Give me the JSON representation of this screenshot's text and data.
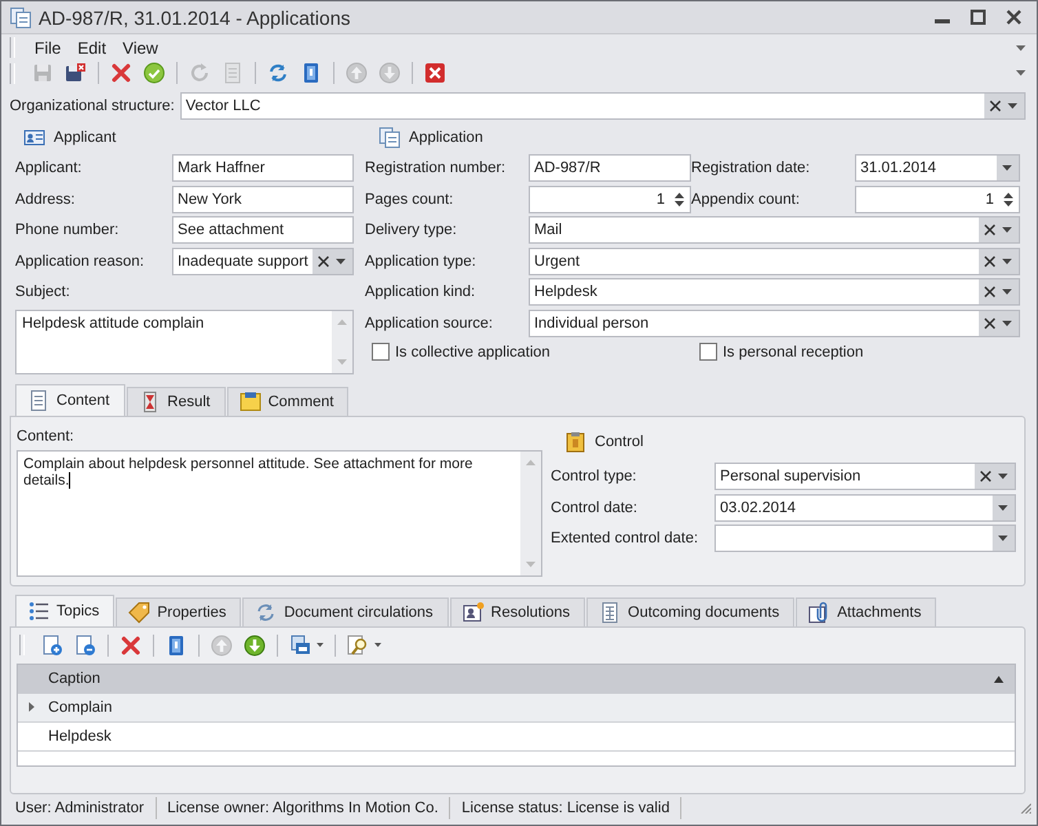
{
  "window": {
    "title": "AD-987/R, 31.01.2014 - Applications"
  },
  "menu": [
    "File",
    "Edit",
    "View"
  ],
  "toolbar": [
    [
      {
        "kind": "save",
        "disabled": true
      },
      {
        "kind": "save-close",
        "disabled": false
      }
    ],
    [
      {
        "kind": "delete",
        "disabled": false
      },
      {
        "kind": "accept",
        "disabled": false
      }
    ],
    [
      {
        "kind": "refresh",
        "disabled": true
      },
      {
        "kind": "document",
        "disabled": true
      }
    ],
    [
      {
        "kind": "sync",
        "disabled": false
      },
      {
        "kind": "book",
        "disabled": false
      }
    ],
    [
      {
        "kind": "up",
        "disabled": true
      },
      {
        "kind": "down",
        "disabled": true
      }
    ],
    [
      {
        "kind": "close",
        "disabled": false
      }
    ]
  ],
  "org_structure": {
    "label": "Organizational structure:",
    "value": "Vector LLC"
  },
  "applicant": {
    "title": "Applicant",
    "fields": [
      {
        "label": "Applicant:",
        "value": "Mark Haffner",
        "kind": "text"
      },
      {
        "label": "Address:",
        "value": "New York",
        "kind": "text"
      },
      {
        "label": "Phone number:",
        "value": "See attachment",
        "kind": "text"
      },
      {
        "label": "Application reason:",
        "value": "Inadequate support",
        "kind": "lookup"
      }
    ],
    "subject": {
      "label": "Subject:",
      "value": "Helpdesk attitude complain"
    }
  },
  "application": {
    "title": "Application",
    "rows": [
      {
        "fields": [
          {
            "label": "Registration number:",
            "value": "AD-987/R",
            "kind": "text"
          },
          {
            "label": "Registration date:",
            "value": "31.01.2014",
            "kind": "date"
          }
        ]
      },
      {
        "fields": [
          {
            "label": "Pages count:",
            "value": "1",
            "kind": "spin"
          },
          {
            "label": "Appendix count:",
            "value": "1",
            "kind": "spin"
          }
        ]
      },
      {
        "fields": [
          {
            "label": "Delivery type:",
            "value": "Mail",
            "kind": "lookup"
          }
        ]
      },
      {
        "fields": [
          {
            "label": "Application type:",
            "value": "Urgent",
            "kind": "lookup"
          }
        ]
      },
      {
        "fields": [
          {
            "label": "Application kind:",
            "value": "Helpdesk",
            "kind": "lookup"
          }
        ]
      },
      {
        "fields": [
          {
            "label": "Application source:",
            "value": "Individual person",
            "kind": "lookup"
          }
        ]
      }
    ],
    "checkboxes": [
      {
        "label": "Is collective application",
        "checked": false
      },
      {
        "label": "Is personal reception",
        "checked": false
      }
    ]
  },
  "detail_tabs": [
    {
      "label": "Content",
      "kind": "content",
      "selected": true
    },
    {
      "label": "Result",
      "kind": "result",
      "selected": false
    },
    {
      "label": "Comment",
      "kind": "comment",
      "selected": false
    }
  ],
  "content": {
    "label": "Content:",
    "value": "Complain about helpdesk personnel attitude. See attachment for more details."
  },
  "control": {
    "title": "Control",
    "fields": [
      {
        "label": "Control type:",
        "value": "Personal supervision",
        "kind": "lookup"
      },
      {
        "label": "Control date:",
        "value": "03.02.2014",
        "kind": "date"
      },
      {
        "label": "Extented control date:",
        "kind": "date"
      }
    ]
  },
  "bottom_tabs": [
    {
      "label": "Topics",
      "kind": "topics",
      "selected": true
    },
    {
      "label": "Properties",
      "kind": "properties",
      "selected": false
    },
    {
      "label": "Document circulations",
      "kind": "circulations",
      "selected": false
    },
    {
      "label": "Resolutions",
      "kind": "resolutions",
      "selected": false
    },
    {
      "label": "Outcoming documents",
      "kind": "outcoming",
      "selected": false
    },
    {
      "label": "Attachments",
      "kind": "attachments",
      "selected": false
    }
  ],
  "grid_toolbar": [
    [
      {
        "kind": "add-row",
        "disabled": false,
        "menu": false
      },
      {
        "kind": "remove-row",
        "disabled": false,
        "menu": false
      }
    ],
    [
      {
        "kind": "delete",
        "disabled": false,
        "menu": false
      }
    ],
    [
      {
        "kind": "book",
        "disabled": false,
        "menu": false
      }
    ],
    [
      {
        "kind": "up",
        "disabled": true,
        "menu": false
      },
      {
        "kind": "down-green",
        "disabled": false,
        "menu": false
      }
    ],
    [
      {
        "kind": "export",
        "disabled": false,
        "menu": true
      }
    ],
    [
      {
        "kind": "find",
        "disabled": false,
        "menu": true
      }
    ]
  ],
  "grid": {
    "columns": [
      "Caption"
    ],
    "rows": [
      {
        "cells": [
          "Complain"
        ],
        "selected": true
      },
      {
        "cells": [
          "Helpdesk"
        ],
        "selected": false
      }
    ]
  },
  "status_bar": [
    "User: Administrator",
    "License owner: Algorithms In Motion Co.",
    "License status: License is valid"
  ]
}
